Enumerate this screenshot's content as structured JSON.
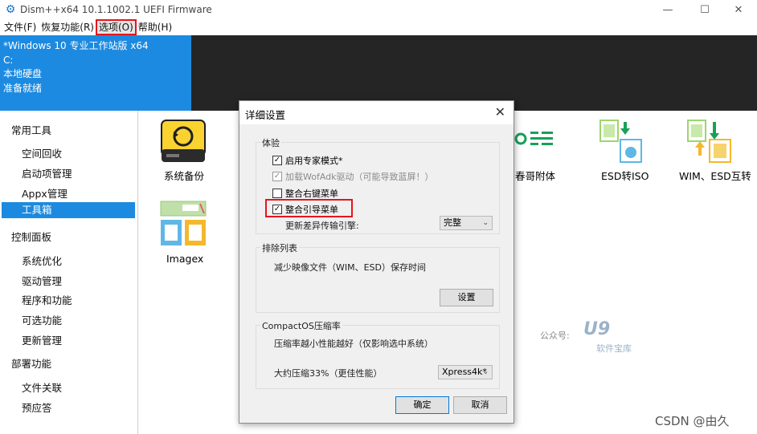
{
  "window": {
    "title": "Dism++x64 10.1.1002.1 UEFI Firmware",
    "min": "—",
    "max": "☐",
    "close": "✕"
  },
  "menu": [
    "文件(F)",
    "恢复功能(R)",
    "选项(O)",
    "帮助(H)"
  ],
  "info": [
    "*Windows 10 专业工作站版 x64",
    "C:",
    "本地硬盘",
    "准备就绪"
  ],
  "sidebar": {
    "sections": [
      {
        "label": "常用工具",
        "items": [
          "空间回收",
          "启动项管理",
          "Appx管理",
          "工具箱"
        ]
      },
      {
        "label": "控制面板",
        "items": [
          "系统优化",
          "驱动管理",
          "程序和功能",
          "可选功能",
          "更新管理"
        ]
      },
      {
        "label": "部署功能",
        "items": [
          "文件关联",
          "预应答"
        ]
      }
    ],
    "active": "工具箱"
  },
  "tools": [
    "系统备份",
    "Imagex",
    "春哥附体",
    "ESD转ISO",
    "WIM、ESD互转"
  ],
  "dialog": {
    "title": "详细设置",
    "close": "✕",
    "exp_group": {
      "title": "体验",
      "opt1": "启用专家模式*",
      "opt2": "加载WofAdk驱动（可能导致蓝屏！）",
      "opt3": "整合右键菜单",
      "opt4": "整合引导菜单",
      "engine_label": "更新差异传输引擎:",
      "engine_value": "完整"
    },
    "excl_group": {
      "title": "排除列表",
      "desc": "减少映像文件（WIM、ESD）保存时间",
      "button": "设置"
    },
    "compact_group": {
      "title": "CompactOS压缩率",
      "desc": "压缩率越小性能越好（仅影响选中系统）",
      "ratio_label": "大约压缩33%（更佳性能）",
      "ratio_value": "Xpress4k*"
    },
    "ok": "确定",
    "cancel": "取消"
  },
  "watermark": {
    "label": "公众号:",
    "logo": "U9",
    "sub": "软件宝库"
  },
  "csdn": "CSDN @由久",
  "colors": {
    "accent": "#1c8ae0",
    "highlight": "#e8141b",
    "dark_band": "#252526"
  }
}
